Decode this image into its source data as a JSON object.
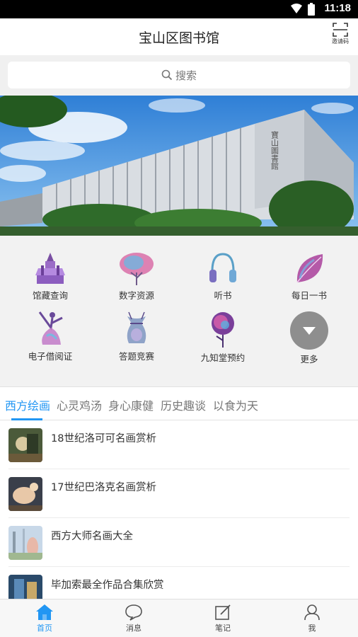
{
  "status_bar": {
    "time": "11:18"
  },
  "header": {
    "title": "宝山区图书馆",
    "scan_label": "邀请码"
  },
  "search": {
    "placeholder": "搜索"
  },
  "banner": {
    "building_sign": "寶山圖書館"
  },
  "features": [
    {
      "label": "馆藏查询",
      "icon": "palace-icon"
    },
    {
      "label": "数字资源",
      "icon": "tree-icon"
    },
    {
      "label": "听书",
      "icon": "headphones-icon"
    },
    {
      "label": "每日一书",
      "icon": "leaf-icon"
    },
    {
      "label": "电子借阅证",
      "icon": "dancer-icon"
    },
    {
      "label": "答题竞赛",
      "icon": "pouch-icon"
    },
    {
      "label": "九知堂预约",
      "icon": "rose-icon"
    },
    {
      "label": "更多",
      "icon": "chevron-down-icon"
    }
  ],
  "tabs": [
    "西方绘画",
    "心灵鸡汤",
    "身心康健",
    "历史趣谈",
    "以食为天"
  ],
  "active_tab": "西方绘画",
  "articles": [
    {
      "title": "18世纪洛可可名画赏析"
    },
    {
      "title": "17世纪巴洛克名画赏析"
    },
    {
      "title": "西方大师名画大全"
    },
    {
      "title": "毕加索最全作品合集欣赏"
    }
  ],
  "bottom_nav": [
    {
      "label": "首页",
      "icon": "home-icon"
    },
    {
      "label": "消息",
      "icon": "message-icon"
    },
    {
      "label": "笔记",
      "icon": "note-icon"
    },
    {
      "label": "我",
      "icon": "user-icon"
    }
  ],
  "colors": {
    "accent": "#2196f3",
    "more_button": "#8e8e8e"
  }
}
